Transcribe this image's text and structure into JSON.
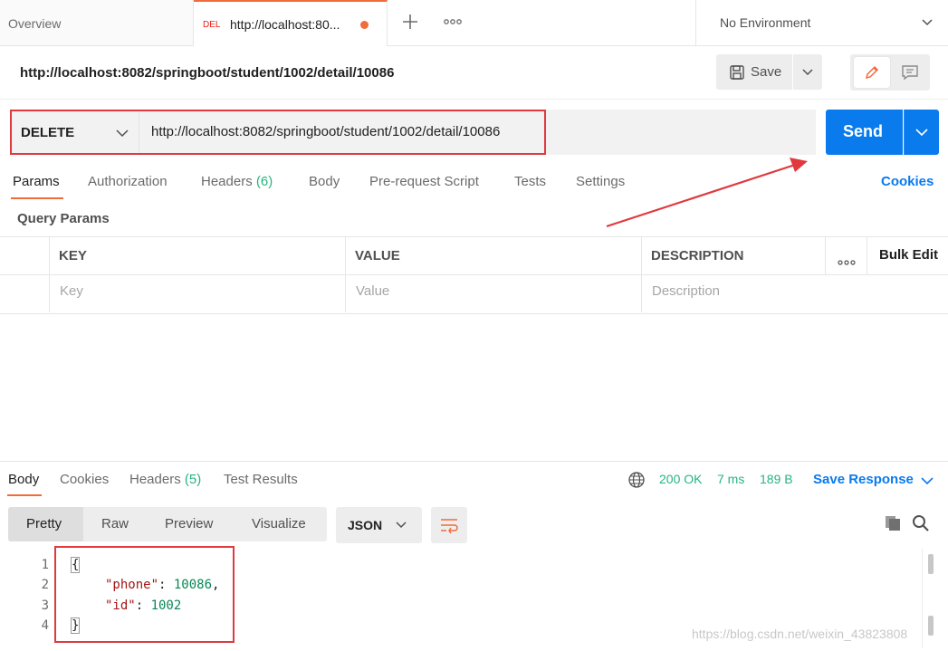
{
  "tabs": {
    "overview_label": "Overview",
    "active_method": "DEL",
    "active_title": "http://localhost:80...",
    "unsaved_dot_color": "#f26b3a"
  },
  "environment": {
    "label": "No Environment"
  },
  "request": {
    "name": "http://localhost:8082/springboot/student/1002/detail/10086",
    "save_label": "Save",
    "method": "DELETE",
    "url": "http://localhost:8082/springboot/student/1002/detail/10086",
    "send_label": "Send"
  },
  "request_tabs": {
    "params": "Params",
    "authorization": "Authorization",
    "headers": "Headers",
    "headers_count": "(6)",
    "body": "Body",
    "pre_request": "Pre-request Script",
    "tests": "Tests",
    "settings": "Settings",
    "cookies": "Cookies"
  },
  "query_params": {
    "title": "Query Params",
    "columns": {
      "key": "KEY",
      "value": "VALUE",
      "description": "DESCRIPTION"
    },
    "bulk_edit": "Bulk Edit",
    "placeholders": {
      "key": "Key",
      "value": "Value",
      "description": "Description"
    }
  },
  "response": {
    "tabs": {
      "body": "Body",
      "cookies": "Cookies",
      "headers": "Headers",
      "headers_count": "(5)",
      "test_results": "Test Results"
    },
    "status": "200 OK",
    "time": "7 ms",
    "size": "189 B",
    "save_response": "Save Response",
    "views": {
      "pretty": "Pretty",
      "raw": "Raw",
      "preview": "Preview",
      "visualize": "Visualize"
    },
    "format": "JSON",
    "code": {
      "line_numbers": [
        "1",
        "2",
        "3",
        "4"
      ],
      "open_brace": "{",
      "close_brace": "}",
      "phone_key": "\"phone\"",
      "phone_value": "10086",
      "id_key": "\"id\"",
      "id_value": "1002",
      "colon": ": ",
      "comma": ","
    }
  },
  "watermark": "https://blog.csdn.net/weixin_43823808",
  "colors": {
    "accent": "#f26b3a",
    "primary": "#097bed",
    "success": "#26b47f",
    "highlight": "#e0393e"
  }
}
